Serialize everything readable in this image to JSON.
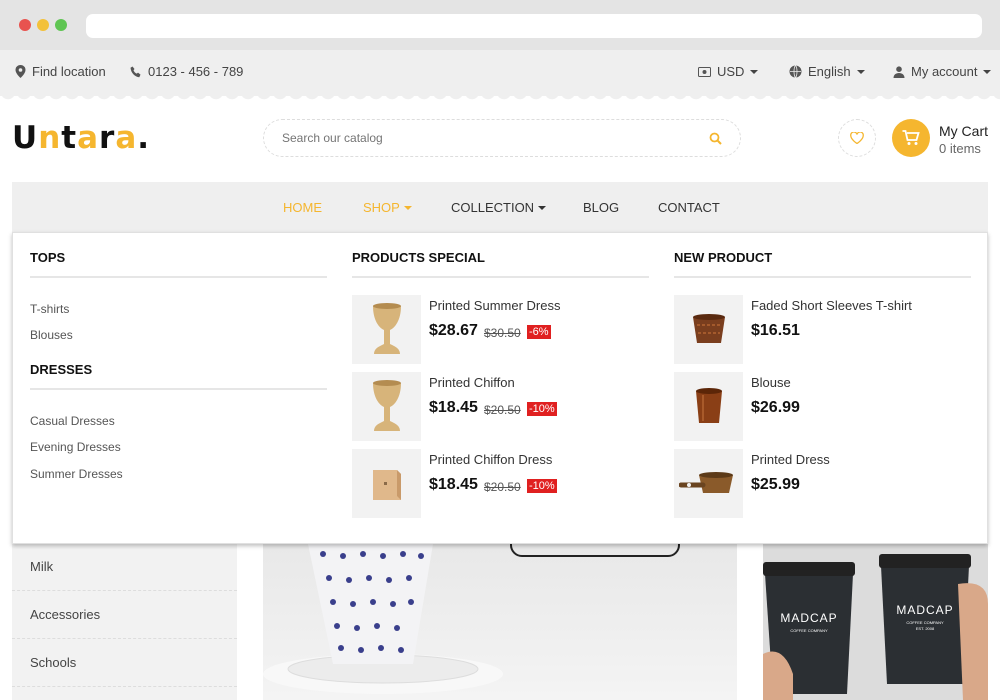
{
  "topbar": {
    "location": "Find location",
    "phone": "0123 - 456 - 789",
    "currency": "USD",
    "language": "English",
    "account": "My account"
  },
  "logo": {
    "text": "Untara."
  },
  "search": {
    "placeholder": "Search our catalog"
  },
  "cart": {
    "title": "My Cart",
    "count": "0 items"
  },
  "nav": {
    "home": "HOME",
    "shop": "SHOP",
    "collection": "COLLECTION",
    "blog": "BLOG",
    "contact": "CONTACT"
  },
  "mega": {
    "tops": {
      "heading": "TOPS",
      "links": [
        "T-shirts",
        "Blouses"
      ]
    },
    "dresses": {
      "heading": "DRESSES",
      "links": [
        "Casual Dresses",
        "Evening Dresses",
        "Summer Dresses"
      ]
    },
    "special": {
      "heading": "PRODUCTS SPECIAL",
      "items": [
        {
          "name": "Printed Summer Dress",
          "price": "$28.67",
          "old": "$30.50",
          "discount": "-6%"
        },
        {
          "name": "Printed Chiffon",
          "price": "$18.45",
          "old": "$20.50",
          "discount": "-10%"
        },
        {
          "name": "Printed Chiffon Dress",
          "price": "$18.45",
          "old": "$20.50",
          "discount": "-10%"
        }
      ]
    },
    "newp": {
      "heading": "NEW PRODUCT",
      "items": [
        {
          "name": "Faded Short Sleeves T-shirt",
          "price": "$16.51"
        },
        {
          "name": "Blouse",
          "price": "$26.99"
        },
        {
          "name": "Printed Dress",
          "price": "$25.99"
        }
      ]
    }
  },
  "sidebar": {
    "items": [
      "Milk",
      "Accessories",
      "Schools"
    ]
  },
  "banner": {
    "cup_brand": "MADCAP",
    "cup_sub": "COFFEE COMPANY",
    "cup_est": "EST. 2008"
  },
  "colors": {
    "accent": "#f5b62f",
    "discount": "#e02020"
  }
}
